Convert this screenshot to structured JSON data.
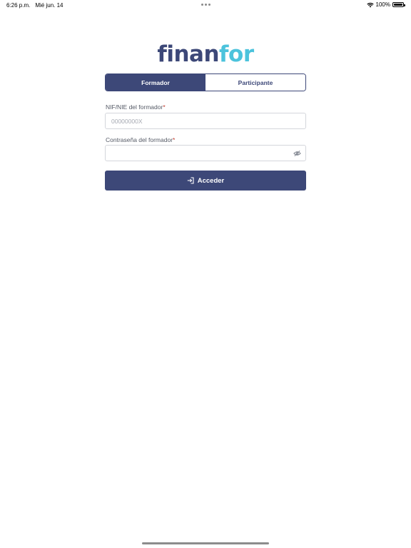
{
  "status_bar": {
    "time": "6:26 p.m.",
    "date": "Mié jun. 14",
    "battery": "100%",
    "battery_level": 1.0
  },
  "logo": {
    "part_a": "finan",
    "part_b": "for"
  },
  "tabs": [
    {
      "label": "Formador",
      "active": true
    },
    {
      "label": "Participante",
      "active": false
    }
  ],
  "form": {
    "nif_label": "NIF/NIE del formador",
    "nif_placeholder": "00000000X",
    "nif_value": "",
    "password_label": "Contraseña del formador",
    "password_value": "",
    "required_mark": "*",
    "submit_label": "Acceder",
    "password_toggle_icon": "eye-off-icon",
    "submit_icon": "login-icon"
  },
  "colors": {
    "primary": "#3d4878",
    "accent": "#4cc3dc",
    "required": "#c0392b"
  }
}
